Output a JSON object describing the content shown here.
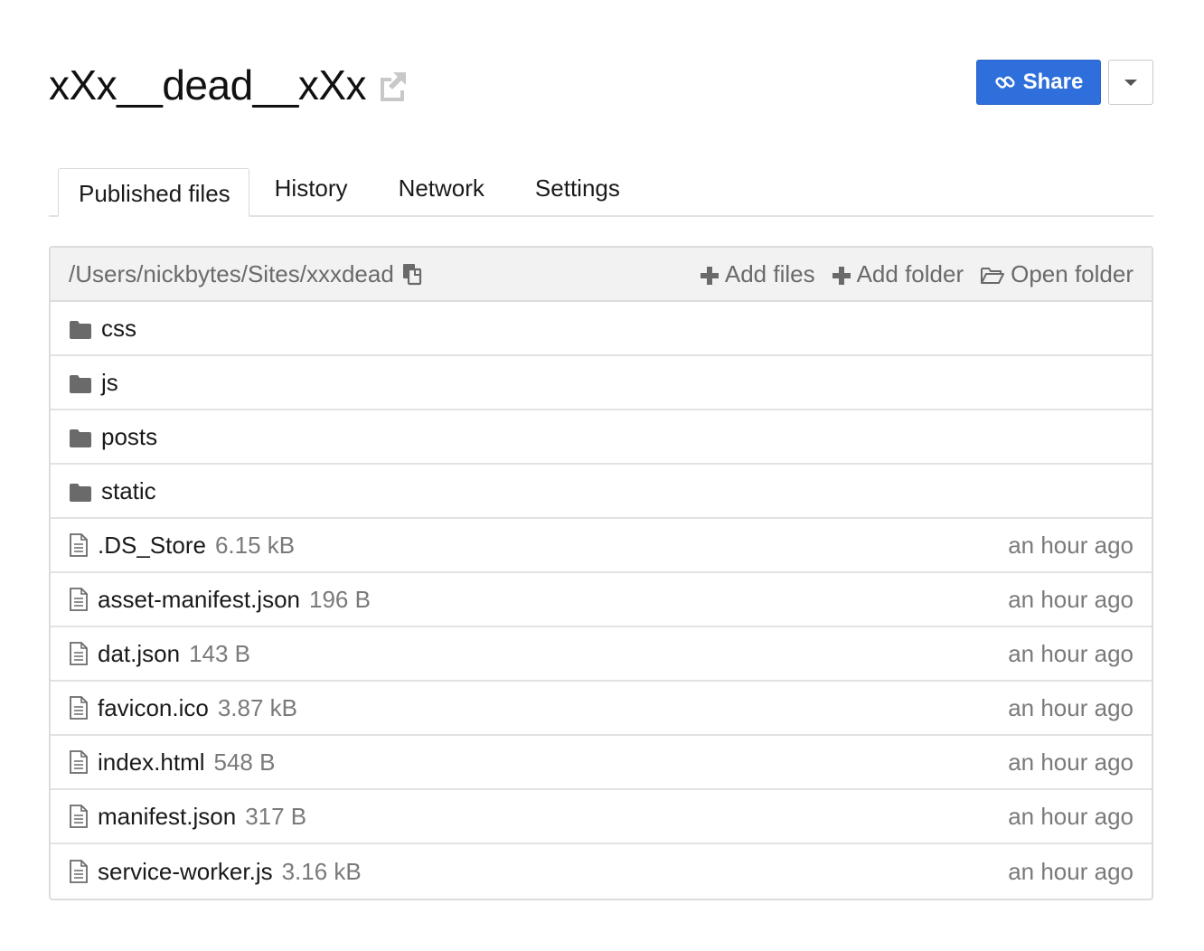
{
  "header": {
    "title": "xXx__dead__xXx",
    "share_label": "Share"
  },
  "tabs": [
    {
      "label": "Published files",
      "active": true
    },
    {
      "label": "History"
    },
    {
      "label": "Network"
    },
    {
      "label": "Settings"
    }
  ],
  "panel": {
    "path": "/Users/nickbytes/Sites/xxxdead",
    "add_files_label": "Add files",
    "add_folder_label": "Add folder",
    "open_folder_label": "Open folder"
  },
  "folders": [
    {
      "name": "css"
    },
    {
      "name": "js"
    },
    {
      "name": "posts"
    },
    {
      "name": "static"
    }
  ],
  "files": [
    {
      "name": ".DS_Store",
      "size": "6.15 kB",
      "modified": "an hour ago"
    },
    {
      "name": "asset-manifest.json",
      "size": "196 B",
      "modified": "an hour ago"
    },
    {
      "name": "dat.json",
      "size": "143 B",
      "modified": "an hour ago"
    },
    {
      "name": "favicon.ico",
      "size": "3.87 kB",
      "modified": "an hour ago"
    },
    {
      "name": "index.html",
      "size": "548 B",
      "modified": "an hour ago"
    },
    {
      "name": "manifest.json",
      "size": "317 B",
      "modified": "an hour ago"
    },
    {
      "name": "service-worker.js",
      "size": "3.16 kB",
      "modified": "an hour ago"
    }
  ],
  "colors": {
    "accent": "#2f6fdb",
    "muted_text": "#7a7a7a",
    "header_bg": "#f2f2f2"
  }
}
